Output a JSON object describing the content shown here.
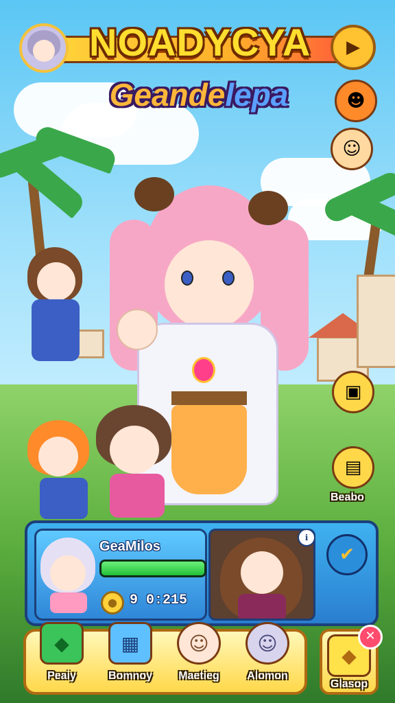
{
  "header": {
    "title": "NOADYCYA",
    "subtitle_part1": "Geande",
    "subtitle_part2": "lepa",
    "play_icon": "play-icon"
  },
  "side_buttons": [
    {
      "name": "smiley-icon",
      "glyph": "☻"
    },
    {
      "name": "friend-avatar-icon",
      "glyph": "☺"
    }
  ],
  "right_menu": [
    {
      "name": "chest-icon",
      "glyph": "▣"
    },
    {
      "name": "shop-icon",
      "glyph": "▤",
      "label": "Beabo"
    }
  ],
  "panel": {
    "name": "GeaMilos",
    "hp_fraction": 1.0,
    "coin_count": "9 0:215",
    "coin_icon": "coin-icon",
    "badge_icon": "info-icon",
    "confirm_icon": "checkmark-icon"
  },
  "nav": [
    {
      "label": "Peaiy",
      "icon": "green-gem-icon",
      "glyph": "◆"
    },
    {
      "label": "Bomnoy",
      "icon": "book-icon",
      "glyph": "▦"
    },
    {
      "label": "Maetieg",
      "icon": "character-icon",
      "glyph": "☺"
    },
    {
      "label": "Alomon",
      "icon": "cat-character-icon",
      "glyph": "☺"
    }
  ],
  "close_card": {
    "label": "Glasop",
    "icon": "gem-icon",
    "glyph": "◆",
    "close_glyph": "✕"
  },
  "colors": {
    "title_yellow": "#ffde2f",
    "hp_green": "#22c03a",
    "panel_blue": "#2a7ed0",
    "accent_pink": "#f7a7c6"
  }
}
